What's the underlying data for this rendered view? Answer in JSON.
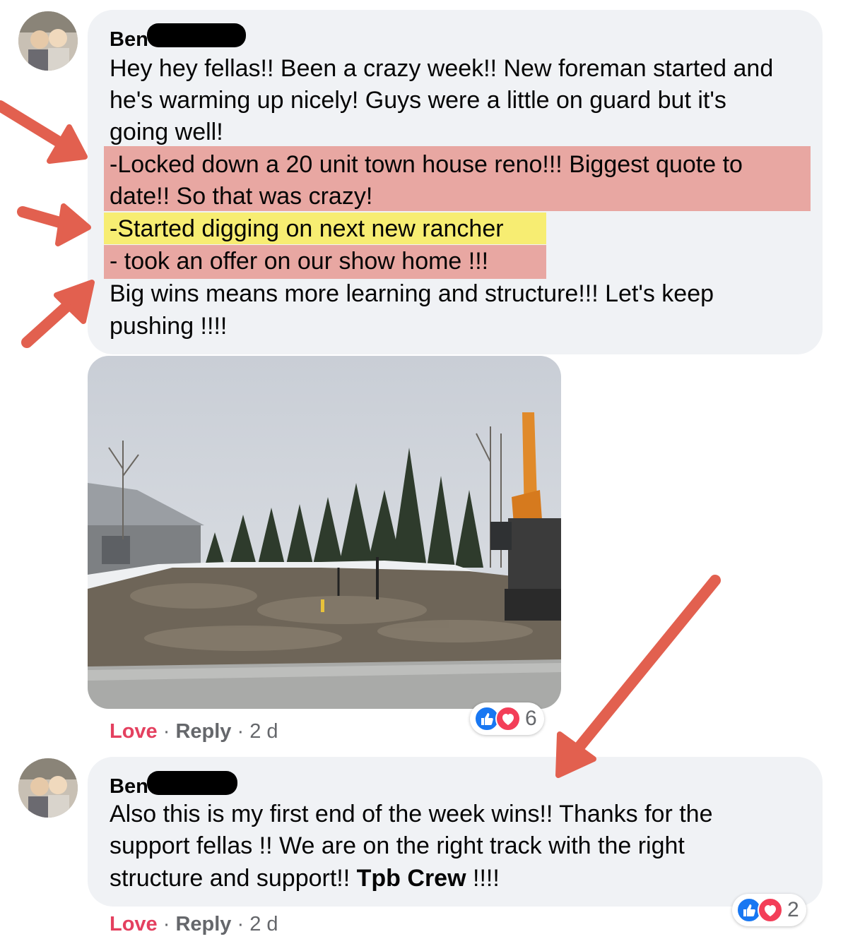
{
  "comment1": {
    "author": "Ben",
    "lines": [
      "Hey hey fellas!! Been a crazy week!! New foreman started and",
      "he's warming up nicely! Guys were a little on guard but it's",
      "going well!",
      "-Locked down a 20 unit town house reno!!! Biggest quote to",
      "date!! So that was crazy!",
      "-Started digging on next new rancher",
      "- took an offer on our show home !!!",
      "Big wins means more learning and structure!!! Let's keep",
      "pushing !!!!"
    ],
    "actions": {
      "love": "Love",
      "sep1": " · ",
      "reply": "Reply",
      "sep2": " · ",
      "time": "2 d"
    },
    "reaction_count": "6"
  },
  "comment2": {
    "author": "Ben",
    "lines": [
      "Also this is my first end of the week wins!! Thanks for the",
      "support fellas !! We are on the right track with the right",
      "structure and support!! "
    ],
    "bold_tail": "Tpb Crew",
    "tail": " !!!!",
    "actions": {
      "love": "Love",
      "sep1": " · ",
      "reply": "Reply",
      "sep2": " · ",
      "time": "2 d"
    },
    "reaction_count": "2"
  },
  "colors": {
    "bubble": "#f0f2f5",
    "love": "#e4405f",
    "arrow": "#e2604f",
    "highlight_red": "#e26a5c",
    "highlight_yellow": "#f8ec5a",
    "like_blue": "#1877f2"
  },
  "icons": {
    "like": "thumbs-up-icon",
    "love": "heart-icon"
  }
}
